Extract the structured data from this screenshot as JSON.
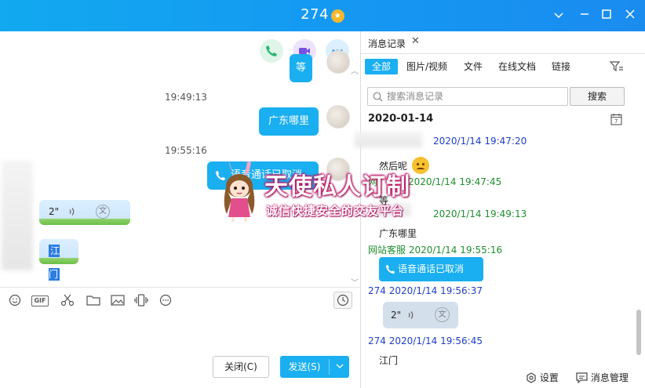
{
  "window": {
    "title": "274",
    "badge_glyph": "★",
    "controls": {
      "minimize": "⌄",
      "min": "—",
      "max": "☐",
      "close": "✕"
    }
  },
  "chat": {
    "top_partial_bubble": "等",
    "messages": [
      {
        "time": "19:49:13"
      },
      {
        "side": "right",
        "text": "广东哪里"
      },
      {
        "time": "19:55:16"
      },
      {
        "side": "right",
        "text": "语音通话已取消"
      },
      {
        "side": "left",
        "type": "voice",
        "text": "2\"",
        "translate_glyph": "文"
      },
      {
        "side": "left",
        "text": "江门"
      }
    ],
    "toolbar_icons": [
      "emoji-icon",
      "gif-icon",
      "scissors-icon",
      "folder-icon",
      "image-icon",
      "vibrate-icon",
      "more-icon"
    ],
    "gif_label": "GIF",
    "close_button": "关闭(C)",
    "send_button": "发送(S)",
    "send_dropdown": "⌄"
  },
  "history": {
    "tab_label": "消息记录",
    "tab_close": "✕",
    "filters": [
      "全部",
      "图片/视频",
      "文件",
      "在线文档",
      "链接"
    ],
    "active_filter": "全部",
    "search_placeholder": "搜索消息记录",
    "search_button": "搜索",
    "date": "2020-01-14",
    "entries": [
      {
        "sender": "",
        "datetime": "2020/1/14 19:47:20",
        "text": "然后呢",
        "color": "#1e3fc7"
      },
      {
        "sender": "网",
        "datetime": "2020/1/14 19:47:45",
        "text": "等",
        "color": "#1f8f2f"
      },
      {
        "sender": "",
        "datetime": "2020/1/14 19:49:13",
        "text": "广东哪里",
        "color": "#1f8f2f"
      },
      {
        "sender": "网站客服",
        "datetime": "2020/1/14 19:55:16",
        "text": "语音通话已取消",
        "color": "#1f8f2f"
      },
      {
        "sender": "274",
        "datetime": "2020/1/14 19:56:37",
        "text": "2\"",
        "color": "#1e3fc7"
      },
      {
        "sender": "274",
        "datetime": "2020/1/14 19:56:45",
        "text": "江门",
        "color": "#1e3fc7"
      }
    ],
    "settings_label": "设置",
    "manage_label": "消息管理"
  },
  "watermark": {
    "line1": "天使私人订制",
    "line2": "诚信快捷安全的交友平台"
  },
  "colors": {
    "accent": "#1aaff0",
    "titlebar": "#1596f2",
    "green_sender": "#1f8f2f",
    "blue_sender": "#1e3fc7"
  }
}
